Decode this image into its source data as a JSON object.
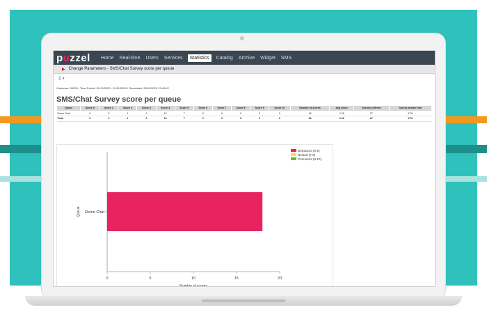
{
  "nav": {
    "logo_text": "p",
    "logo_dot": "u",
    "logo_rest": "zzel",
    "items": [
      "Home",
      "Real-time",
      "Users",
      "Services",
      "Statistics",
      "Catalog",
      "Archive",
      "Widget",
      "SMS"
    ],
    "active": "Statistics"
  },
  "subbar": {
    "label": "Change Parameters - SMS/Chat Survey score per queue"
  },
  "toolbar": {
    "export_icon": "export-icon"
  },
  "meta": {
    "text": "Customer: 99206 / Time Period: 01/10/2020 - 01/11/2020 / Generated: 26/11/2020 13:40:12"
  },
  "report": {
    "title": "SMS/Chat Survey score per queue",
    "columns": [
      "Queue",
      "Score 0",
      "Score 1",
      "Score 2",
      "Score 3",
      "Score 4",
      "Score 5",
      "Score 6",
      "Score 7",
      "Score 8",
      "Score 9",
      "Score 10",
      "Number of scores",
      "Avg score",
      "Surveys offered",
      "Survey answer rate"
    ],
    "rows": [
      [
        "Demo Chat",
        "0",
        "0",
        "1",
        "0",
        "10",
        "7",
        "0",
        "0",
        "0",
        "0",
        "0",
        "18",
        "4.28",
        "27",
        "67%"
      ]
    ],
    "total": [
      "Total",
      "0",
      "0",
      "1",
      "0",
      "10",
      "7",
      "0",
      "0",
      "0",
      "0",
      "0",
      "18",
      "4.28",
      "27",
      "67%"
    ]
  },
  "chart_data": {
    "type": "bar",
    "orientation": "horizontal",
    "categories": [
      "Demo Chat"
    ],
    "series": [
      {
        "name": "Detractors (0-6)",
        "values": [
          18
        ],
        "color": "#e8235f"
      },
      {
        "name": "Neutral (7-8)",
        "values": [
          0
        ],
        "color": "#f5e33b"
      },
      {
        "name": "Promotors (9-10)",
        "values": [
          0
        ],
        "color": "#5fbf3a"
      }
    ],
    "xlabel": "Number of scores",
    "ylabel": "Queue",
    "xlim": [
      0,
      20
    ],
    "xticks": [
      "0",
      "5",
      "10",
      "15",
      "20"
    ],
    "legend": "top-right",
    "grid": false
  }
}
